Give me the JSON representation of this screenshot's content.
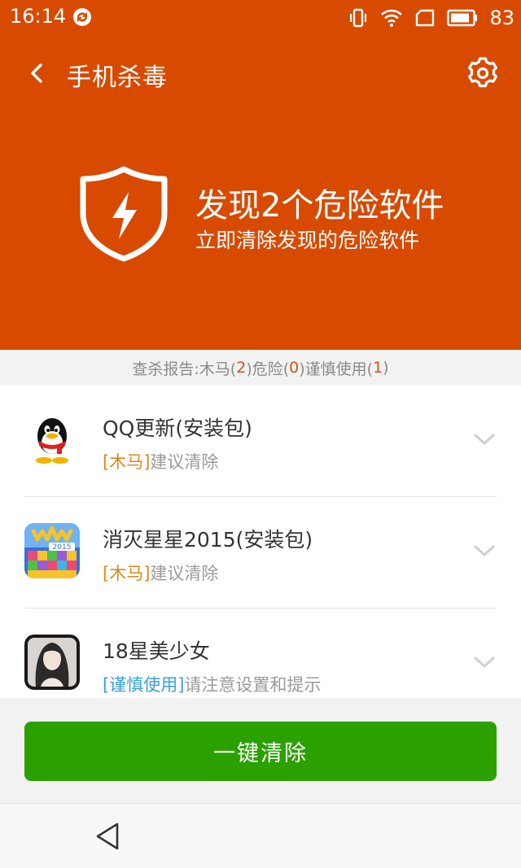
{
  "status_bar": {
    "time": "16:14",
    "battery": "83",
    "icons": [
      "sync-icon",
      "vibrate-icon",
      "wifi-icon",
      "sim-icon",
      "battery-icon"
    ]
  },
  "header": {
    "title": "手机杀毒",
    "back_icon": "back-arrow-icon",
    "settings_icon": "gear-icon",
    "result_title": "发现2个危险软件",
    "result_subtitle": "立即清除发现的危险软件",
    "shield_icon": "shield-lightning-icon",
    "color": "#d84a00"
  },
  "report": {
    "prefix": "查杀报告:木马(",
    "trojan_count": "2",
    "mid1": ")危险(",
    "danger_count": "0",
    "mid2": ")谨慎使用(",
    "caution_count": "1",
    "suffix": ")"
  },
  "items": [
    {
      "name": "QQ更新(安装包)",
      "tag": "[木马]",
      "tag_type": "danger",
      "desc": "建议清除",
      "icon": "qq-penguin-icon"
    },
    {
      "name": "消灭星星2015(安装包)",
      "tag": "[木马]",
      "tag_type": "danger",
      "desc": "建议清除",
      "icon": "popstar-game-icon"
    },
    {
      "name": "18星美少女",
      "tag": "[谨慎使用]",
      "tag_type": "caution",
      "desc": "请注意设置和提示",
      "icon": "girl-app-icon"
    }
  ],
  "action": {
    "clean_label": "一键清除",
    "color": "#2ba100"
  },
  "nav": {
    "back_icon": "nav-back-triangle-icon"
  }
}
